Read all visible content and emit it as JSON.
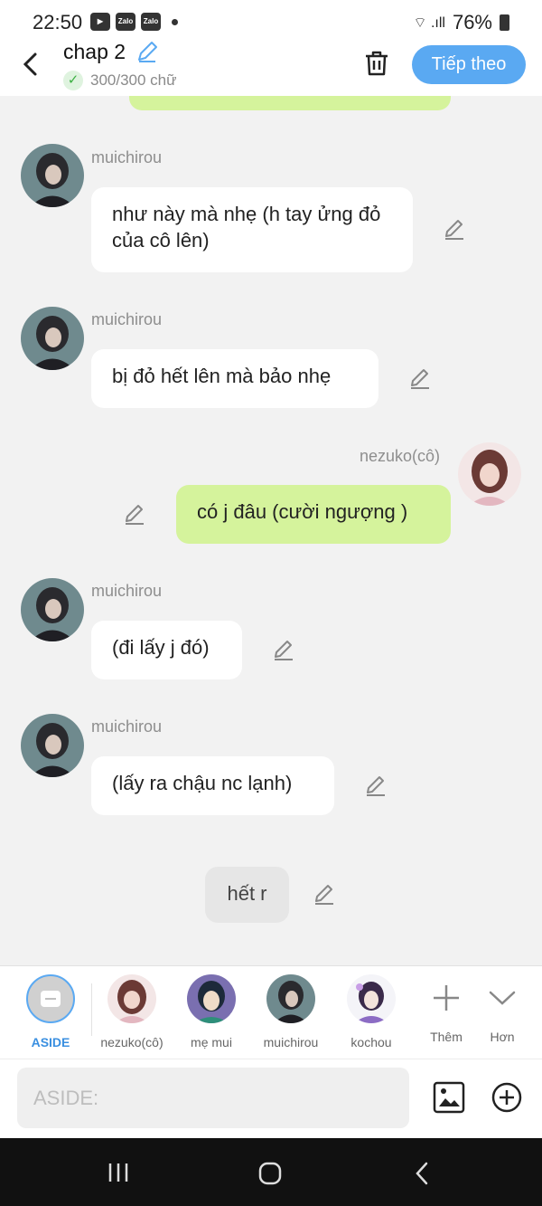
{
  "status_bar": {
    "time": "22:50",
    "battery": "76%",
    "app_icons": [
      "youtube-icon",
      "zalo-icon",
      "zalo-icon"
    ]
  },
  "header": {
    "back_icon": "chevron-left-icon",
    "title": "chap 2",
    "char_count": "300/300 chữ",
    "next_label": "Tiếp theo"
  },
  "messages": [
    {
      "speaker": "muichirou",
      "side": "left",
      "text": "như này mà nhẹ (h tay ửng đỏ của cô lên)"
    },
    {
      "speaker": "muichirou",
      "side": "left",
      "text": "bị đỏ hết lên mà bảo nhẹ"
    },
    {
      "speaker": "nezuko(cô)",
      "side": "right",
      "text": "có j đâu (cười ngượng )"
    },
    {
      "speaker": "muichirou",
      "side": "left",
      "text": "(đi lấy j đó)"
    },
    {
      "speaker": "muichirou",
      "side": "left",
      "text": "(lấy ra chậu nc lạnh)"
    },
    {
      "speaker": "",
      "side": "center",
      "text": "hết r"
    }
  ],
  "characters": [
    {
      "label": "ASIDE",
      "selected": true
    },
    {
      "label": "nezuko(cô)"
    },
    {
      "label": "mẹ mui"
    },
    {
      "label": "muichirou"
    },
    {
      "label": "kochou"
    }
  ],
  "actions": {
    "add_label": "Thêm",
    "more_label": "Hơn"
  },
  "composer": {
    "placeholder": "ASIDE:"
  },
  "colors": {
    "accent": "#5aa9f2",
    "own_bubble": "#d5f39c",
    "background": "#f2f2f2"
  }
}
